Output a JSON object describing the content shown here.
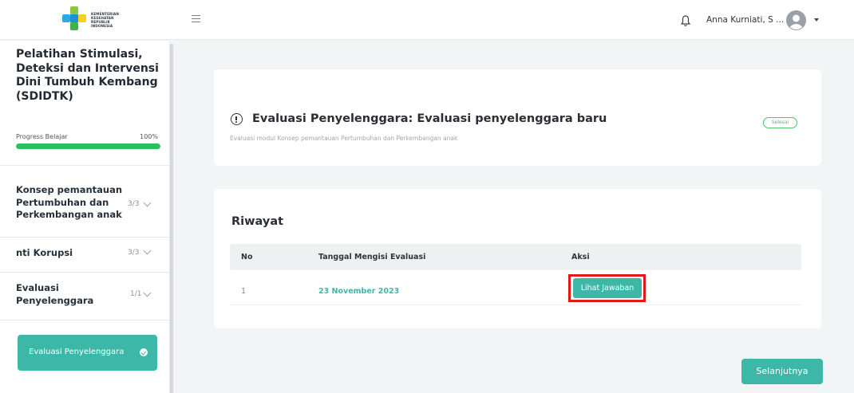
{
  "header": {
    "logo_lines": [
      "KEMENTERIAN",
      "KESEHATAN",
      "REPUBLIK",
      "INDONESIA"
    ],
    "menu_icon": "hamburger-icon",
    "bell_icon": "bell-icon",
    "user_name": "Anna Kurniati, S ...",
    "avatar_icon": "user-avatar-icon",
    "dropdown_icon": "caret-down-icon"
  },
  "sidebar": {
    "course_title": "Pelatihan Stimulasi, Deteksi dan Intervensi Dini Tumbuh Kembang (SDIDTK)",
    "progress_label": "Progress Belajar",
    "progress_percent": "100%",
    "progress_value": 1.0,
    "modules": [
      {
        "title": "Konsep pemantauan Pertumbuhan dan Perkembangan anak",
        "count": "3/3"
      },
      {
        "title": "nti Korupsi",
        "count": "3/3"
      },
      {
        "title": "Evaluasi Penyelenggara",
        "count": "1/1"
      }
    ],
    "active_item": "Evaluasi Penyelenggara"
  },
  "evaluation": {
    "title": "Evaluasi Penyelenggara: Evaluasi penyelenggara baru",
    "subtitle": "Evaluasi modul Konsep pemantauan Pertumbuhan dan Perkembangan anak",
    "status": "Selesai"
  },
  "history": {
    "title": "Riwayat",
    "columns": [
      "No",
      "Tanggal Mengisi Evaluasi",
      "Aksi"
    ],
    "rows": [
      {
        "no": "1",
        "date": "23 November 2023",
        "action": "Lihat Jawaban"
      }
    ]
  },
  "footer": {
    "next_label": "Selanjutnya"
  },
  "colors": {
    "accent": "#3db8a8",
    "progress": "#27c25b",
    "highlight": "#e31818",
    "status": "#4cc26d"
  }
}
